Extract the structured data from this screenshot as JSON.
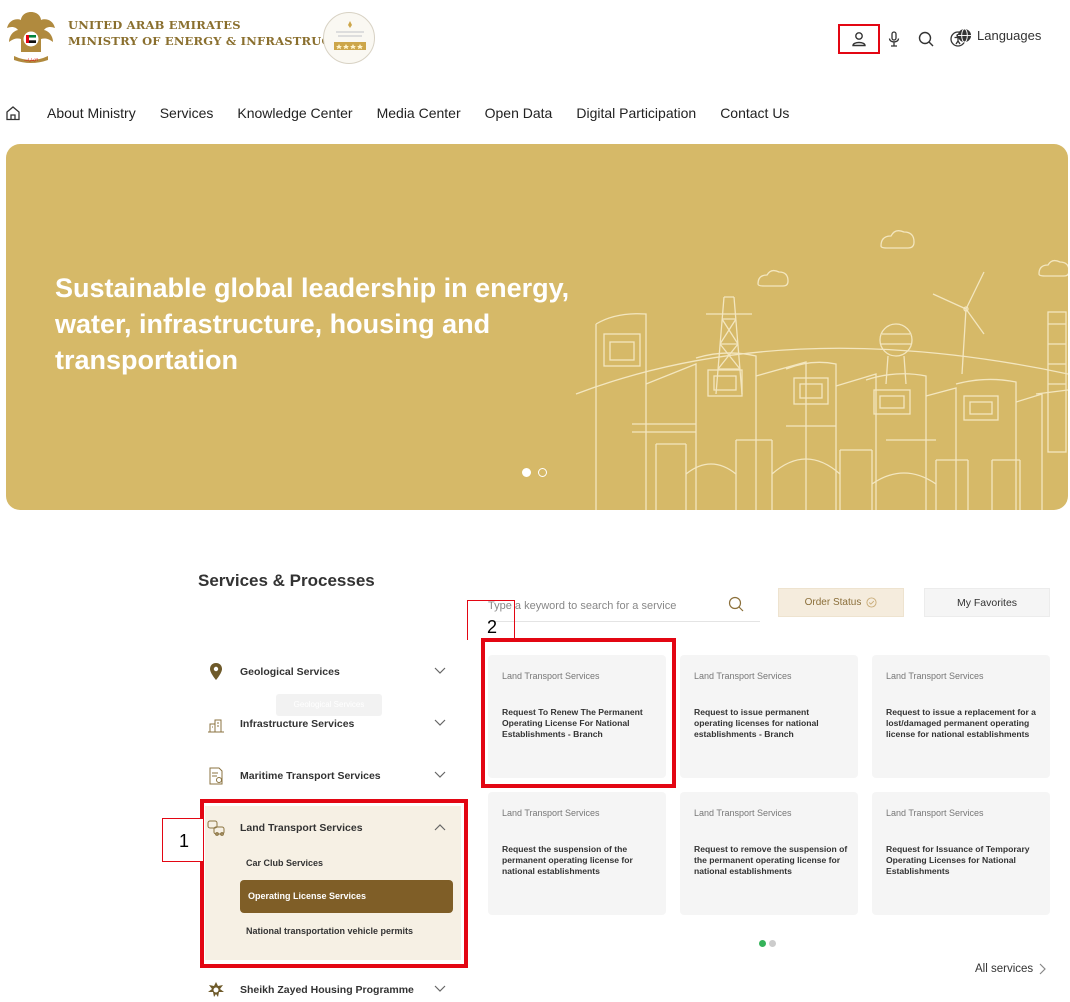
{
  "header": {
    "ministry_line1": "UNITED ARAB EMIRATES",
    "ministry_line2": "MINISTRY OF ENERGY & INFRASTRUCTURE",
    "languages_label": "Languages"
  },
  "nav": {
    "items": [
      "About Ministry",
      "Services",
      "Knowledge Center",
      "Media Center",
      "Open Data",
      "Digital Participation",
      "Contact Us"
    ]
  },
  "hero": {
    "title": "Sustainable global leadership in energy, water, infrastructure, housing and transportation",
    "slide_count": 2,
    "active_slide": 1
  },
  "services": {
    "section_title": "Services & Processes",
    "search_placeholder": "Type a keyword to search for a service",
    "order_status_label": "Order Status",
    "favorites_label": "My Favorites",
    "categories": [
      {
        "label": "Geological Services",
        "icon": "location-pin-icon"
      },
      {
        "label": "Infrastructure Services",
        "icon": "buildings-icon"
      },
      {
        "label": "Maritime Transport Services",
        "icon": "document-gear-icon"
      },
      {
        "label": "Land Transport Services",
        "icon": "vehicles-icon"
      },
      {
        "label": "Sheikh Zayed Housing Programme",
        "icon": "emblem-icon"
      }
    ],
    "tooltip": "Geological Services",
    "land_subitems": [
      "Car Club Services",
      "Operating License Services",
      "National transportation vehicle permits"
    ],
    "cards": [
      {
        "category": "Land Transport Services",
        "title": "Request To Renew The Permanent Operating License For National Establishments - Branch"
      },
      {
        "category": "Land Transport Services",
        "title": "Request to issue permanent operating licenses for national establishments - Branch"
      },
      {
        "category": "Land Transport Services",
        "title": "Request to issue a replacement for a lost/damaged permanent operating license for national establishments"
      },
      {
        "category": "Land Transport Services",
        "title": "Request the suspension of the permanent operating license for national establishments"
      },
      {
        "category": "Land Transport Services",
        "title": "Request to remove the suspension of the permanent operating license for national establishments"
      },
      {
        "category": "Land Transport Services",
        "title": "Request for Issuance of Temporary Operating Licenses for National Establishments"
      }
    ],
    "carousel_pages": 2,
    "all_services_label": "All services"
  },
  "annotations": {
    "label_1": "1",
    "label_2": "2",
    "highlight_color": "#e30613"
  },
  "colors": {
    "hero_bg": "#d6b968",
    "brand_brown": "#7f5e27",
    "gold_text": "#8a6f2e"
  }
}
